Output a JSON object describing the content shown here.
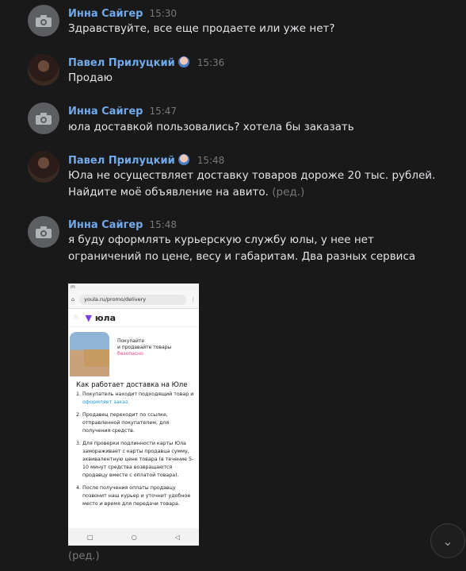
{
  "messages": [
    {
      "author": "Инна Сайгер",
      "time": "15:30",
      "lines": [
        "Здравствуйте, все еще продаете или уже нет?"
      ],
      "edited": ""
    },
    {
      "author": "Павел Прилуцкий",
      "time": "15:36",
      "lines": [
        "Продаю"
      ],
      "edited": ""
    },
    {
      "author": "Инна Сайгер",
      "time": "15:47",
      "lines": [
        "юла доставкой пользовались? хотела бы заказать"
      ],
      "edited": ""
    },
    {
      "author": "Павел Прилуцкий",
      "time": "15:48",
      "lines": [
        "Юла не осуществляет доставку товаров дороже 20 тыс. рублей.",
        "Найдите моё объявление на авито."
      ],
      "edited": "(ред.)"
    },
    {
      "author": "Инна Сайгер",
      "time": "15:48",
      "lines": [
        "я буду оформлять курьерскую службу юлы, у нее нет",
        "ограничений по цене, весу и габаритам. Два разных сервиса"
      ],
      "edited": "(ред.)"
    }
  ],
  "screenshot": {
    "url": "youla.ru/promo/delivery",
    "logo": "юла",
    "hero_line1": "Покупайте",
    "hero_line2": "и продавайте товары",
    "hero_free": "безопасно",
    "box_label": "юла",
    "how_title": "Как работает доставка на Юле",
    "step1a": "Покупатель находит подходящий товар и ",
    "step1_link": "оформляет заказ.",
    "step2": "Продавец переходит по ссылке, отправленной покупателем, для получения средств.",
    "step3": "Для проверки подлинности карты Юла замораживает с карты продавца сумму, эквивалентную цене товара (в течение 5-10 минут средства возвращаются продавцу вместе с оплатой товара).",
    "step4": "После получения оплаты продавцу позвонит наш курьер и уточнит удобное место и время для передачи товара."
  },
  "icons": {
    "camera": "camera-icon",
    "scroll": "chevron-down-icon"
  }
}
